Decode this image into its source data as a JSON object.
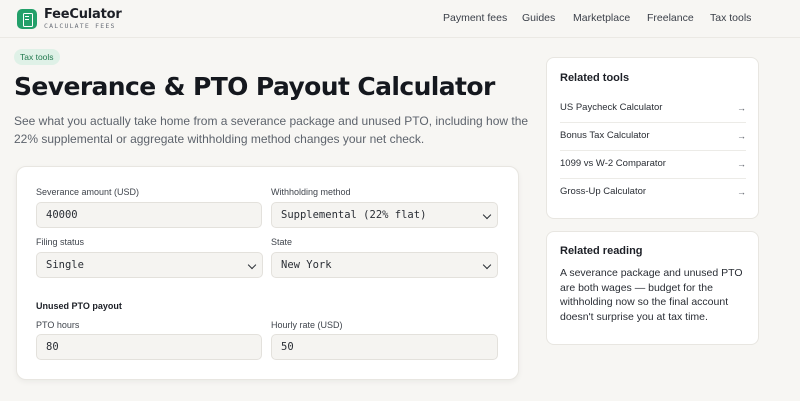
{
  "brand": {
    "name": "FeeCulator",
    "tagline": "CALCULATE FEES"
  },
  "nav": {
    "items": [
      "Payment fees",
      "Guides",
      "Marketplace",
      "Freelance",
      "Tax tools"
    ]
  },
  "header": {
    "tag": "Tax tools",
    "title": "Severance & PTO Payout Calculator",
    "subtitle": "See what you actually take home from a severance package and unused PTO, including how the 22% supplemental or aggregate withholding method changes your net check."
  },
  "form": {
    "severance": {
      "label": "Severance amount (USD)",
      "value": "40000"
    },
    "withholding": {
      "label": "Withholding method",
      "value": "Supplemental (22% flat)"
    },
    "filing": {
      "label": "Filing status",
      "value": "Single"
    },
    "state": {
      "label": "State",
      "value": "New York"
    },
    "pto_section": "Unused PTO payout",
    "pto_hours": {
      "label": "PTO hours",
      "value": "80"
    },
    "hourly_rate": {
      "label": "Hourly rate (USD)",
      "value": "50"
    }
  },
  "related_tools": {
    "title": "Related tools",
    "items": [
      {
        "label": "US Paycheck Calculator",
        "arrow": "→"
      },
      {
        "label": "Bonus Tax Calculator",
        "arrow": "→"
      },
      {
        "label": "1099 vs W-2 Comparator",
        "arrow": "→"
      },
      {
        "label": "Gross-Up Calculator",
        "arrow": "→"
      }
    ]
  },
  "related_reading": {
    "title": "Related reading",
    "body": "A severance package and unused PTO are both wages — budget for the withholding now so the final account doesn't surprise you at tax time."
  },
  "colors": {
    "brand_green": "#23a06a",
    "tag_bg": "#dff1e7",
    "page_bg": "#f7f6f3"
  }
}
